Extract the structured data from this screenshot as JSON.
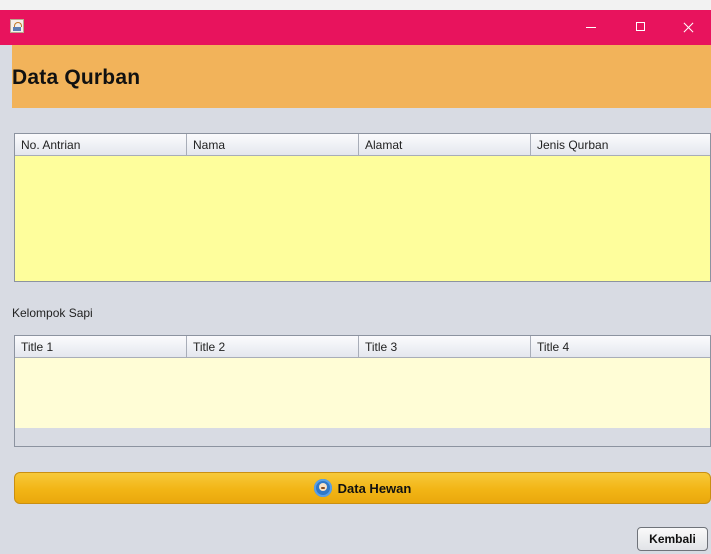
{
  "window": {
    "icon": "java-coffee-cup-icon",
    "controls": {
      "minimize": "minimize-icon",
      "maximize": "maximize-icon",
      "close": "close-icon"
    }
  },
  "header": {
    "title": "Data Qurban"
  },
  "antrian_table": {
    "columns": [
      "No. Antrian",
      "Nama",
      "Alamat",
      "Jenis Qurban"
    ],
    "rows": []
  },
  "sapi_section": {
    "label": "Kelompok Sapi",
    "columns": [
      "Title 1",
      "Title 2",
      "Title 3",
      "Title 4"
    ],
    "rows": []
  },
  "buttons": {
    "data_hewan": {
      "label": "Data Hewan",
      "icon": "animal-face-icon"
    },
    "kembali": {
      "label": "Kembali"
    }
  },
  "colors": {
    "titlebar": "#e8135d",
    "header": "#f2b35a",
    "table1_body": "#fefe9c",
    "table2_body": "#fffdd6",
    "button_accent": "#f2b515"
  }
}
